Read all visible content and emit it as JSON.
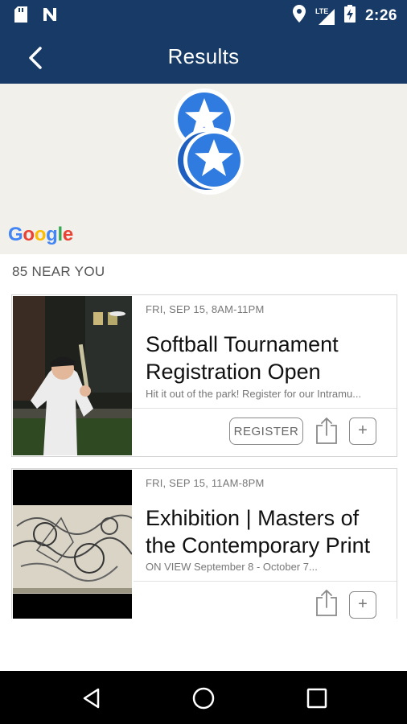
{
  "status_bar": {
    "time": "2:26",
    "network": "LTE",
    "icons": [
      "sd-card-icon",
      "notification-n-icon",
      "location-icon",
      "signal-icon",
      "battery-charging-icon"
    ]
  },
  "app_bar": {
    "title": "Results",
    "back_icon": "back-arrow-icon"
  },
  "map": {
    "attribution": "Google",
    "pins": [
      "star-pin-icon",
      "star-pin-icon"
    ]
  },
  "list": {
    "count_label": "85 NEAR YOU"
  },
  "events": [
    {
      "datetime": "FRI, SEP 15, 8AM-11PM",
      "title": "Softball Tournament Registration Open",
      "description": "Hit it out of the park! Register for our Intramu...",
      "action_label": "REGISTER"
    },
    {
      "datetime": "FRI, SEP 15, 11AM-8PM",
      "title": "Exhibition | Masters of the Contemporary Print",
      "description": "ON VIEW September 8 - October 7..."
    }
  ],
  "nav_bar": {
    "buttons": [
      "back-triangle-icon",
      "home-circle-icon",
      "recents-square-icon"
    ]
  },
  "colors": {
    "primary": "#173b66",
    "pin_blue": "#2f7be0",
    "map_bg": "#f1f0eb"
  }
}
